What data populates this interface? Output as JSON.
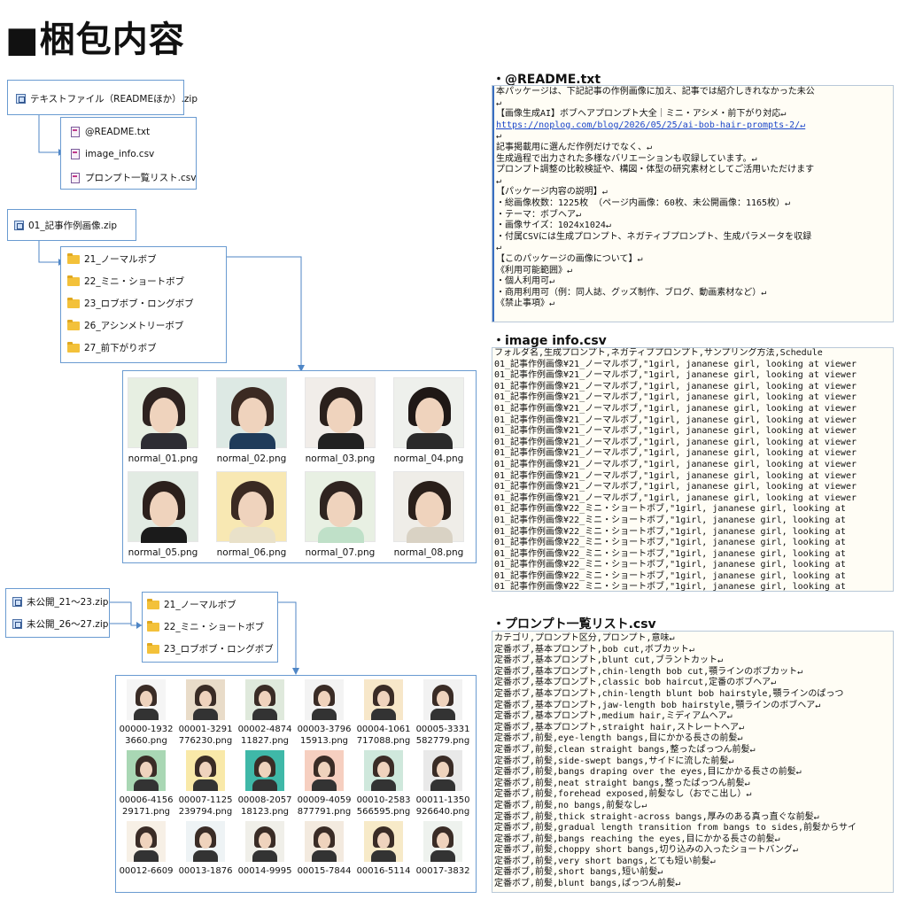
{
  "title": "■梱包内容",
  "tree": {
    "zip1": "テキストファイル（READMEほか）.zip",
    "text_files": [
      "@README.txt",
      "image_info.csv",
      "プロンプト一覧リスト.csv"
    ],
    "zip2": "01_記事作例画像.zip",
    "folders1": [
      "21_ノーマルボブ",
      "22_ミニ・ショートボブ",
      "23_ロブボブ・ロングボブ",
      "26_アシンメトリーボブ",
      "27_前下がりボブ"
    ],
    "normal_images": [
      "normal_01.png",
      "normal_02.png",
      "normal_03.png",
      "normal_04.png",
      "normal_05.png",
      "normal_06.png",
      "normal_07.png",
      "normal_08.png"
    ],
    "zip3": "未公開_21〜23.zip",
    "zip4": "未公開_26〜27.zip",
    "folders2": [
      "21_ノーマルボブ",
      "22_ミニ・ショートボブ",
      "23_ロブボブ・ロングボブ"
    ],
    "unpublished_images": [
      [
        "00000-1932",
        "3660.png"
      ],
      [
        "00001-3291",
        "776230.png"
      ],
      [
        "00002-4874",
        "11827.png"
      ],
      [
        "00003-3796",
        "15913.png"
      ],
      [
        "00004-1061",
        "717088.png"
      ],
      [
        "00005-3331",
        "582779.png"
      ],
      [
        "00006-4156",
        "29171.png"
      ],
      [
        "00007-1125",
        "239794.png"
      ],
      [
        "00008-2057",
        "18123.png"
      ],
      [
        "00009-4059",
        "877791.png"
      ],
      [
        "00010-2583",
        "566595.png"
      ],
      [
        "00011-1350",
        "926640.png"
      ],
      [
        "00012-6609",
        ""
      ],
      [
        "00013-1876",
        ""
      ],
      [
        "00014-9995",
        ""
      ],
      [
        "00015-7844",
        ""
      ],
      [
        "00016-5114",
        ""
      ],
      [
        "00017-3832",
        ""
      ]
    ]
  },
  "colors": {
    "normal_bg": [
      "#e7efe2",
      "#dde9e4",
      "#f1ede9",
      "#eef0ec",
      "#e2ebe3",
      "#f8e8b3",
      "#e8f0e3",
      "#efede8"
    ],
    "unpub_bg": [
      "#f5f5f5",
      "#e9dcc9",
      "#dfe9dc",
      "#f3f3f3",
      "#f7e7c9",
      "#f2f2f2",
      "#a9d7b4",
      "#f9e9a9",
      "#3fb8a8",
      "#f6cfc0",
      "#cfe8dc",
      "#e9e9e9",
      "#f7f0e6",
      "#eef3f5",
      "#f0efe9",
      "#f3eadf",
      "#f7eac8",
      "#eef2ee"
    ]
  },
  "readme": {
    "heading": "・@README.txt",
    "lines": [
      "本パッケージは、下記記事の作例画像に加え、記事では紹介しきれなかった未公",
      "↵",
      "【画像生成AI】ボブヘアプロンプト大全｜ミニ・アシメ・前下がり対応↵",
      "https://noplog.com/blog/2026/05/25/ai-bob-hair-prompts-2/↵",
      "↵",
      "記事掲載用に選んだ作例だけでなく、↵",
      "生成過程で出力された多様なバリエーションも収録しています。↵",
      "プロンプト調整の比較検証や、構図・体型の研究素材としてご活用いただけます",
      "↵",
      "【パッケージ内容の説明】↵",
      "・総画像枚数：1225枚 （ページ内画像：60枚、未公開画像：1165枚）↵",
      "・テーマ：ボブヘア↵",
      "・画像サイズ：1024x1024↵",
      "・付属CSVには生成プロンプト、ネガティブプロンプト、生成パラメータを収録",
      "↵",
      "【このパッケージの画像について】↵",
      "《利用可能範囲》↵",
      "・個人利用可↵",
      "・商用利用可（例：同人誌、グッズ制作、ブログ、動画素材など）↵",
      "《禁止事項》↵"
    ]
  },
  "image_info": {
    "heading": "・image info.csv",
    "lines": [
      "フォルダ名,生成プロンプト,ネガティブプロンプト,サンプリング方法,Schedule",
      "01_記事作例画像¥21_ノーマルボブ,\"1girl, jananese girl, looking at viewer",
      "01_記事作例画像¥21_ノーマルボブ,\"1girl, jananese girl, looking at viewer",
      "01_記事作例画像¥21_ノーマルボブ,\"1girl, jananese girl, looking at viewer",
      "01_記事作例画像¥21_ノーマルボブ,\"1girl, jananese girl, looking at viewer",
      "01_記事作例画像¥21_ノーマルボブ,\"1girl, jananese girl, looking at viewer",
      "01_記事作例画像¥21_ノーマルボブ,\"1girl, jananese girl, looking at viewer",
      "01_記事作例画像¥21_ノーマルボブ,\"1girl, jananese girl, looking at viewer",
      "01_記事作例画像¥21_ノーマルボブ,\"1girl, jananese girl, looking at viewer",
      "01_記事作例画像¥21_ノーマルボブ,\"1girl, jananese girl, looking at viewer",
      "01_記事作例画像¥21_ノーマルボブ,\"1girl, jananese girl, looking at viewer",
      "01_記事作例画像¥21_ノーマルボブ,\"1girl, jananese girl, looking at viewer",
      "01_記事作例画像¥21_ノーマルボブ,\"1girl, jananese girl, looking at viewer",
      "01_記事作例画像¥21_ノーマルボブ,\"1girl, jananese girl, looking at viewer",
      "01_記事作例画像¥22_ミニ・ショートボブ,\"1girl, jananese girl, looking at",
      "01_記事作例画像¥22_ミニ・ショートボブ,\"1girl, jananese girl, looking at",
      "01_記事作例画像¥22_ミニ・ショートボブ,\"1girl, jananese girl, looking at",
      "01_記事作例画像¥22_ミニ・ショートボブ,\"1girl, jananese girl, looking at",
      "01_記事作例画像¥22_ミニ・ショートボブ,\"1girl, jananese girl, looking at",
      "01_記事作例画像¥22_ミニ・ショートボブ,\"1girl, jananese girl, looking at",
      "01_記事作例画像¥22_ミニ・ショートボブ,\"1girl, jananese girl, looking at",
      "01_記事作例画像¥22_ミニ・ショートボブ,\"1girl, jananese girl, looking at"
    ]
  },
  "prompt_list": {
    "heading": "・プロンプト一覧リスト.csv",
    "lines": [
      "カテゴリ,プロンプト区分,プロンプト,意味↵",
      "定番ボブ,基本プロンプト,bob cut,ボブカット↵",
      "定番ボブ,基本プロンプト,blunt cut,ブラントカット↵",
      "定番ボブ,基本プロンプト,chin-length bob cut,顎ラインのボブカット↵",
      "定番ボブ,基本プロンプト,classic bob haircut,定番のボブヘア↵",
      "定番ボブ,基本プロンプト,chin-length blunt bob hairstyle,顎ラインのぱっつ",
      "定番ボブ,基本プロンプト,jaw-length bob hairstyle,顎ラインのボブヘア↵",
      "定番ボブ,基本プロンプト,medium hair,ミディアムヘア↵",
      "定番ボブ,基本プロンプト,straight hair,ストレートヘア↵",
      "定番ボブ,前髪,eye-length bangs,目にかかる長さの前髪↵",
      "定番ボブ,前髪,clean straight bangs,整ったぱっつん前髪↵",
      "定番ボブ,前髪,side-swept bangs,サイドに流した前髪↵",
      "定番ボブ,前髪,bangs draping over the eyes,目にかかる長さの前髪↵",
      "定番ボブ,前髪,neat straight bangs,整ったぱっつん前髪↵",
      "定番ボブ,前髪,forehead exposed,前髪なし（おでこ出し）↵",
      "定番ボブ,前髪,no bangs,前髪なし↵",
      "定番ボブ,前髪,thick straight-across bangs,厚みのある真っ直ぐな前髪↵",
      "定番ボブ,前髪,gradual length transition from bangs to sides,前髪からサイ",
      "定番ボブ,前髪,bangs reaching the eyes,目にかかる長さの前髪↵",
      "定番ボブ,前髪,choppy short bangs,切り込みの入ったショートバング↵",
      "定番ボブ,前髪,very short bangs,とても短い前髪↵",
      "定番ボブ,前髪,short bangs,短い前髪↵",
      "定番ボブ,前髪,blunt bangs,ぱっつん前髪↵"
    ]
  }
}
